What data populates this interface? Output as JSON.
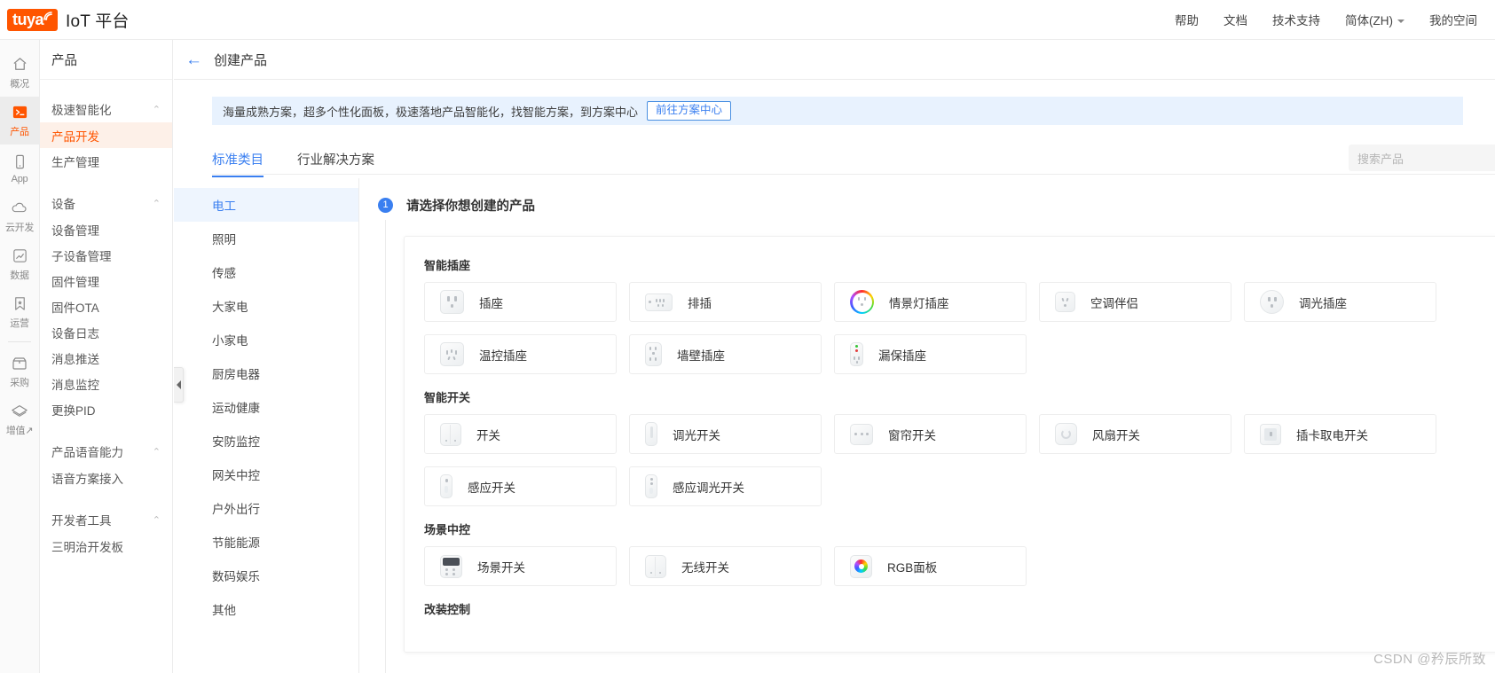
{
  "topbar": {
    "logo_text": "tuya",
    "logo_icon": "wifi-signal-icon",
    "brand_title": "IoT 平台",
    "brand_color": "#ff5500",
    "menu": [
      {
        "label": "帮助"
      },
      {
        "label": "文档"
      },
      {
        "label": "技术支持"
      },
      {
        "label": "简体(ZH)",
        "has_caret": true
      },
      {
        "label": "我的空间"
      }
    ]
  },
  "rail": {
    "items": [
      {
        "label": "概况",
        "icon": "home-icon",
        "active": false
      },
      {
        "label": "产品",
        "icon": "terminal-icon",
        "active": true
      },
      {
        "label": "App",
        "icon": "mobile-icon",
        "active": false
      },
      {
        "label": "云开发",
        "icon": "cloud-icon",
        "active": false
      },
      {
        "label": "数据",
        "icon": "chart-icon",
        "active": false
      },
      {
        "label": "运营",
        "icon": "bookmark-star-icon",
        "active": false
      },
      {
        "label": "采购",
        "icon": "box-icon",
        "active": false
      },
      {
        "label": "增值↗",
        "icon": "diamond-icon",
        "active": false
      }
    ]
  },
  "sidenav": {
    "title": "产品",
    "groups": [
      {
        "label": "极速智能化",
        "items": [
          {
            "label": "产品开发",
            "active": true
          },
          {
            "label": "生产管理",
            "active": false
          }
        ]
      },
      {
        "label": "设备",
        "items": [
          {
            "label": "设备管理",
            "active": false
          },
          {
            "label": "子设备管理",
            "active": false
          },
          {
            "label": "固件管理",
            "active": false
          },
          {
            "label": "固件OTA",
            "active": false
          },
          {
            "label": "设备日志",
            "active": false
          },
          {
            "label": "消息推送",
            "active": false
          },
          {
            "label": "消息监控",
            "active": false
          },
          {
            "label": "更换PID",
            "active": false
          }
        ]
      },
      {
        "label": "产品语音能力",
        "items": [
          {
            "label": "语音方案接入",
            "active": false
          }
        ]
      },
      {
        "label": "开发者工具",
        "items": [
          {
            "label": "三明治开发板",
            "active": false
          }
        ]
      }
    ]
  },
  "page": {
    "back_icon": "back-arrow-icon",
    "title": "创建产品"
  },
  "banner": {
    "text": "海量成熟方案，超多个性化面板，极速落地产品智能化，找智能方案，到方案中心",
    "button_label": "前往方案中心",
    "bg_color": "#e8f2fe",
    "button_color": "#3a7ff0"
  },
  "tabs": {
    "items": [
      {
        "label": "标准类目",
        "active": true
      },
      {
        "label": "行业解决方案",
        "active": false
      }
    ],
    "search_placeholder": "搜索产品"
  },
  "categories": [
    {
      "label": "电工",
      "active": true
    },
    {
      "label": "照明",
      "active": false
    },
    {
      "label": "传感",
      "active": false
    },
    {
      "label": "大家电",
      "active": false
    },
    {
      "label": "小家电",
      "active": false
    },
    {
      "label": "厨房电器",
      "active": false
    },
    {
      "label": "运动健康",
      "active": false
    },
    {
      "label": "安防监控",
      "active": false
    },
    {
      "label": "网关中控",
      "active": false
    },
    {
      "label": "户外出行",
      "active": false
    },
    {
      "label": "节能能源",
      "active": false
    },
    {
      "label": "数码娱乐",
      "active": false
    },
    {
      "label": "其他",
      "active": false
    }
  ],
  "step": {
    "number": "1",
    "title": "请选择你想创建的产品"
  },
  "sections": [
    {
      "title": "智能插座",
      "rows": [
        [
          {
            "label": "插座",
            "icon": "socket-icon"
          },
          {
            "label": "排插",
            "icon": "power-strip-icon"
          },
          {
            "label": "情景灯插座",
            "icon": "scene-light-socket-icon"
          },
          {
            "label": "空调伴侣",
            "icon": "ac-companion-icon"
          },
          {
            "label": "调光插座",
            "icon": "dimmer-socket-icon"
          }
        ],
        [
          {
            "label": "温控插座",
            "icon": "thermostat-socket-icon"
          },
          {
            "label": "墙壁插座",
            "icon": "wall-socket-icon"
          },
          {
            "label": "漏保插座",
            "icon": "leakage-protect-socket-icon"
          }
        ]
      ]
    },
    {
      "title": "智能开关",
      "rows": [
        [
          {
            "label": "开关",
            "icon": "switch-icon"
          },
          {
            "label": "调光开关",
            "icon": "dimmer-switch-icon"
          },
          {
            "label": "窗帘开关",
            "icon": "curtain-switch-icon"
          },
          {
            "label": "风扇开关",
            "icon": "fan-switch-icon"
          },
          {
            "label": "插卡取电开关",
            "icon": "card-power-switch-icon"
          }
        ],
        [
          {
            "label": "感应开关",
            "icon": "sensor-switch-icon"
          },
          {
            "label": "感应调光开关",
            "icon": "sensor-dimmer-switch-icon"
          }
        ]
      ]
    },
    {
      "title": "场景中控",
      "rows": [
        [
          {
            "label": "场景开关",
            "icon": "scene-switch-icon"
          },
          {
            "label": "无线开关",
            "icon": "wireless-switch-icon"
          },
          {
            "label": "RGB面板",
            "icon": "rgb-panel-icon"
          }
        ]
      ]
    },
    {
      "title": "改装控制",
      "rows": []
    }
  ],
  "watermark": "CSDN @矜辰所致"
}
